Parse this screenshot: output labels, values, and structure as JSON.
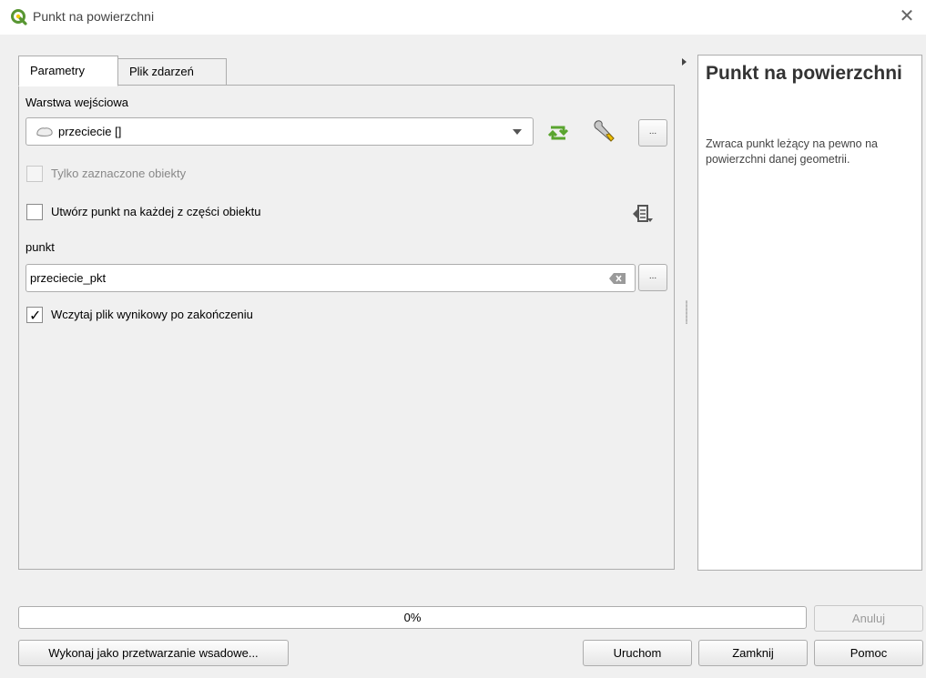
{
  "window": {
    "title": "Punkt na powierzchni"
  },
  "tabs": [
    {
      "label": "Parametry",
      "active": true
    },
    {
      "label": "Plik zdarzeń",
      "active": false
    }
  ],
  "params": {
    "input_layer_label": "Warstwa wejściowa",
    "input_layer_value": "przeciecie []",
    "selected_only_label": "Tylko zaznaczone obiekty",
    "selected_only_checked": false,
    "each_part_label": "Utwórz punkt na każdej z części obiektu",
    "each_part_checked": false,
    "output_label": "punkt",
    "output_value": "przeciecie_pkt",
    "load_result_label": "Wczytaj plik wynikowy po zakończeniu",
    "load_result_checked": true,
    "ellipsis": "..."
  },
  "help": {
    "title": "Punkt na powierzchni",
    "description": "Zwraca punkt leżący na pewno na powierzchni danej geometrii."
  },
  "progress": {
    "text": "0%",
    "value": 0
  },
  "buttons": {
    "cancel": "Anuluj",
    "batch": "Wykonaj jako przetwarzanie wsadowe...",
    "run": "Uruchom",
    "close": "Zamknij",
    "help": "Pomoc"
  },
  "colors": {
    "qgis_green": "#589632",
    "progress_fill": "#06b025"
  }
}
